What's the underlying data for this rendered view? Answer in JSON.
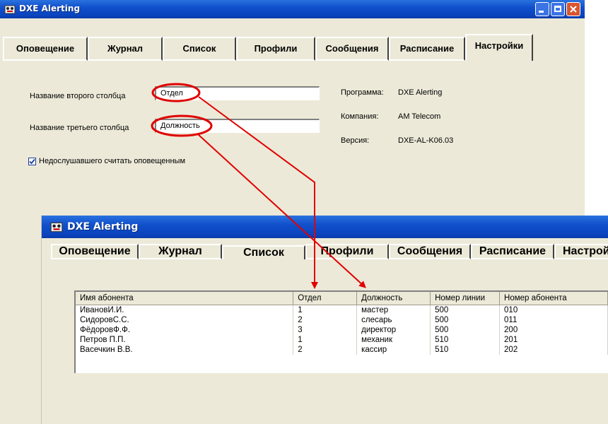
{
  "window_title": "DXE Alerting",
  "tabs": [
    "Оповещение",
    "Журнал",
    "Список",
    "Профили",
    "Сообщения",
    "Расписание",
    "Настройки"
  ],
  "settings": {
    "second_column_label": "Название второго столбца",
    "second_column_value": "Отдел",
    "third_column_label": "Название третьего столбца",
    "third_column_value": "Должность",
    "checkbox_label": "Недослушавшего считать оповещенным",
    "checkbox_checked": true
  },
  "info": {
    "program_label": "Программа:",
    "program_value": "DXE Alerting",
    "company_label": "Компания:",
    "company_value": "AM Telecom",
    "version_label": "Версия:",
    "version_value": "DXE-AL-K06.03"
  },
  "table": {
    "headers": [
      "Имя абонента",
      "Отдел",
      "Должность",
      "Номер линии",
      "Номер абонента"
    ],
    "rows": [
      [
        "ИвановИ.И.",
        "1",
        "мастер",
        "500",
        "010"
      ],
      [
        "СидоровС.С.",
        "2",
        "слесарь",
        "500",
        "011"
      ],
      [
        "ФёдоровФ.Ф.",
        "3",
        "директор",
        "500",
        "200"
      ],
      [
        "Петров П.П.",
        "1",
        "механик",
        "510",
        "201"
      ],
      [
        "Васечкин В.В.",
        "2",
        "кассир",
        "510",
        "202"
      ]
    ]
  },
  "colors": {
    "annotation": "#e00000",
    "titlebar": "#0a43bd",
    "window_face": "#ece9d8"
  }
}
